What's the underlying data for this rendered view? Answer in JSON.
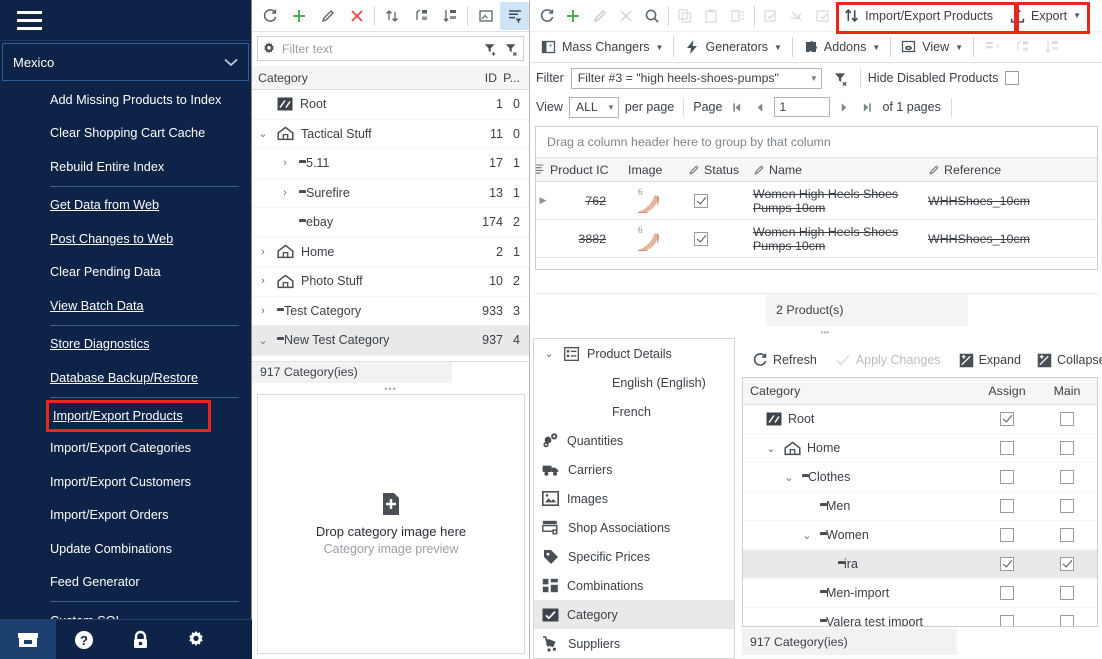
{
  "sidebar": {
    "store_selector": {
      "value": "Mexico",
      "chevron_icon": "chevron-down-icon"
    },
    "menu_groups": [
      {
        "items": [
          {
            "label": "Add Missing Products to Index",
            "mnemonic": ""
          },
          {
            "label": "Clear Shopping Cart Cache",
            "mnemonic": ""
          },
          {
            "label": "Rebuild Entire Index",
            "mnemonic": ""
          }
        ]
      },
      {
        "items": [
          {
            "label": "Get Data from Web",
            "mnemonic": "G"
          },
          {
            "label": "Post Changes to Web",
            "mnemonic": "P"
          },
          {
            "label": "Clear Pending Data",
            "mnemonic": ""
          },
          {
            "label": "View Batch Data",
            "mnemonic": "V"
          }
        ]
      },
      {
        "items": [
          {
            "label": "Store Diagnostics",
            "mnemonic": "D"
          },
          {
            "label": "Database Backup/Restore",
            "mnemonic": "D"
          }
        ]
      },
      {
        "items": [
          {
            "label": "Import/Export Products",
            "mnemonic": "u",
            "highlighted": true
          },
          {
            "label": "Import/Export Categories",
            "mnemonic": ""
          },
          {
            "label": "Import/Export Customers",
            "mnemonic": ""
          },
          {
            "label": "Import/Export Orders",
            "mnemonic": ""
          },
          {
            "label": "Update Combinations",
            "mnemonic": ""
          },
          {
            "label": "Feed Generator",
            "mnemonic": ""
          }
        ]
      },
      {
        "items": [
          {
            "label": "Custom SQL",
            "mnemonic": "Q"
          }
        ]
      }
    ],
    "bottom_bar": [
      {
        "icon": "archive-box-icon",
        "active": true
      },
      {
        "icon": "help-question-icon",
        "active": false
      },
      {
        "icon": "lock-icon",
        "active": false
      },
      {
        "icon": "gear-icon",
        "active": false
      }
    ]
  },
  "category_panel": {
    "toolbar": [
      {
        "icon": "refresh-icon"
      },
      {
        "icon": "add-plus-icon"
      },
      {
        "icon": "edit-pencil-icon"
      },
      {
        "icon": "delete-x-icon"
      },
      {
        "icon": "move-updown-icon"
      },
      {
        "icon": "move-up-level-icon"
      },
      {
        "icon": "sort-descending-icon"
      },
      {
        "icon": "image-toggle-icon"
      },
      {
        "icon": "filter-rows-icon",
        "selected": true
      }
    ],
    "filter_text": {
      "icon": "gear-icon",
      "placeholder": "Filter text",
      "add_filter_icon": "filter-add-icon",
      "clear_filter_icon": "filter-clear-icon"
    },
    "columns": [
      "Category",
      "ID",
      "P..."
    ],
    "rows": [
      {
        "label": "Root",
        "id": "1",
        "p": "0",
        "indent": 0,
        "expander": "",
        "icon": "root-icon",
        "selected": false
      },
      {
        "label": "Tactical Stuff",
        "id": "11",
        "p": "0",
        "indent": 0,
        "expander": "v",
        "icon": "home-icon",
        "selected": false
      },
      {
        "label": "5.11",
        "id": "17",
        "p": "1",
        "indent": 1,
        "expander": ">",
        "icon": "folder-icon",
        "selected": false
      },
      {
        "label": "Surefire",
        "id": "13",
        "p": "1",
        "indent": 1,
        "expander": ">",
        "icon": "folder-icon",
        "selected": false
      },
      {
        "label": "ebay",
        "id": "174",
        "p": "2",
        "indent": 1,
        "expander": "",
        "icon": "folder-icon",
        "selected": false
      },
      {
        "label": "Home",
        "id": "2",
        "p": "1",
        "indent": 0,
        "expander": ">",
        "icon": "home-icon",
        "selected": false
      },
      {
        "label": "Photo Stuff",
        "id": "10",
        "p": "2",
        "indent": 0,
        "expander": ">",
        "icon": "home-icon",
        "selected": false
      },
      {
        "label": "Test Category",
        "id": "933",
        "p": "3",
        "indent": 0,
        "expander": ">",
        "icon": "folder-icon",
        "selected": false
      },
      {
        "label": "New Test Category",
        "id": "937",
        "p": "4",
        "indent": 0,
        "expander": "v",
        "icon": "folder-icon",
        "selected": true
      }
    ],
    "status": "917 Category(ies)",
    "drop_zone": {
      "icon": "add-file-icon",
      "title": "Drop category image here",
      "subtitle": "Category image preview"
    }
  },
  "product_panel": {
    "toolbar_icons": [
      {
        "icon": "refresh-icon",
        "enabled": true
      },
      {
        "icon": "add-plus-icon",
        "enabled": true
      },
      {
        "icon": "edit-pencil-icon",
        "enabled": false
      },
      {
        "icon": "delete-x-icon",
        "enabled": false
      },
      {
        "icon": "search-icon",
        "enabled": true
      },
      {
        "icon": "copy-icon",
        "enabled": false
      },
      {
        "icon": "paste-icon",
        "enabled": false
      },
      {
        "icon": "duplicate-icon",
        "enabled": false
      },
      {
        "icon": "check-all-icon",
        "enabled": false
      },
      {
        "icon": "uncheck-icon",
        "enabled": false
      },
      {
        "icon": "check-selected-icon",
        "enabled": false
      }
    ],
    "import_export_button": {
      "label": "Import/Export Products",
      "mnemonic": "u",
      "icon": "import-export-icon",
      "highlighted": true
    },
    "export_button": {
      "label": "Export",
      "icon": "export-upload-icon",
      "has_caret": true,
      "highlighted": true
    },
    "menu_bar": [
      {
        "label": "Mass Changers",
        "mnemonic": "M",
        "icon": "mass-changers-icon",
        "caret": true
      },
      {
        "label": "Generators",
        "icon": "lightning-icon",
        "caret": true
      },
      {
        "label": "Addons",
        "icon": "puzzle-icon",
        "caret": true
      },
      {
        "label": "View",
        "icon": "eye-view-icon",
        "caret": true
      }
    ],
    "menu_bar_disabled_icons": [
      "sort-alpha-icon",
      "move-up-level-icon",
      "sort-descending-icon"
    ],
    "filter": {
      "label": "Filter",
      "value": "Filter #3 = \"high heels-shoes-pumps\"",
      "clear_icon": "filter-clear-icon",
      "hide_disabled_label": "Hide Disabled Products",
      "hide_disabled_checked": false
    },
    "paging": {
      "view_label": "View",
      "per_page_value": "ALL",
      "per_page_label": "per page",
      "page_label": "Page",
      "page_value": "1",
      "of_pages": "of 1 pages",
      "first_icon": "first-page-icon",
      "prev_icon": "prev-page-icon",
      "next_icon": "next-page-icon",
      "last_icon": "last-page-icon"
    },
    "group_bar_text": "Drag a column header here to group by that column",
    "grid_columns": [
      {
        "label": "Product IC",
        "editable": false
      },
      {
        "label": "Image",
        "editable": false
      },
      {
        "label": "Status",
        "editable": true
      },
      {
        "label": "Name",
        "editable": true
      },
      {
        "label": "Reference",
        "editable": true
      }
    ],
    "grid_rows": [
      {
        "product_id": "762",
        "status_checked": true,
        "name": "Women High Heels Shoes Pumps 10cm",
        "reference": "WHHShoes_10cm",
        "image_icon": "high-heel-shoe-thumbnail",
        "strikethrough": true
      },
      {
        "product_id": "3882",
        "status_checked": true,
        "name": "Women High Heels Shoes Pumps 10cm",
        "reference": "WHHShoes_10cm",
        "image_icon": "high-heel-shoe-thumbnail",
        "strikethrough": true
      }
    ],
    "grid_status": "2 Product(s)"
  },
  "product_details": {
    "header": {
      "label": "Product Details",
      "icon": "details-list-icon",
      "expander": "v"
    },
    "items": [
      {
        "label": "English (English)",
        "icon": "",
        "language": true,
        "selected": false
      },
      {
        "label": "French",
        "icon": "",
        "language": true,
        "selected": false
      },
      {
        "label": "Quantities",
        "icon": "quantities-icon",
        "selected": false
      },
      {
        "label": "Carriers",
        "icon": "truck-carrier-icon",
        "selected": false
      },
      {
        "label": "Images",
        "icon": "image-icon",
        "selected": false
      },
      {
        "label": "Shop Associations",
        "icon": "shop-associations-icon",
        "selected": false
      },
      {
        "label": "Specific Prices",
        "icon": "price-tag-icon",
        "selected": false
      },
      {
        "label": "Combinations",
        "icon": "combinations-icon",
        "selected": false
      },
      {
        "label": "Category",
        "icon": "category-check-icon",
        "selected": true
      },
      {
        "label": "Suppliers",
        "icon": "supplier-cart-icon",
        "selected": false
      }
    ]
  },
  "category_assign_panel": {
    "toolbar": [
      {
        "label": "Refresh",
        "icon": "refresh-icon",
        "enabled": true
      },
      {
        "label": "Apply Changes",
        "icon": "check-apply-icon",
        "enabled": false
      },
      {
        "label": "Expand",
        "icon": "expand-icon",
        "enabled": true
      },
      {
        "label": "Collapse",
        "icon": "collapse-icon",
        "enabled": true
      }
    ],
    "columns": [
      "Category",
      "Assign",
      "Main"
    ],
    "rows": [
      {
        "label": "Root",
        "indent": 0,
        "expander": "",
        "icon": "root-icon",
        "assign": true,
        "main": false,
        "selected": false
      },
      {
        "label": "Home",
        "indent": 1,
        "expander": "v",
        "icon": "home-icon",
        "assign": false,
        "main": false,
        "selected": false
      },
      {
        "label": "Clothes",
        "indent": 2,
        "expander": "v",
        "icon": "folder-icon",
        "assign": false,
        "main": false,
        "selected": false
      },
      {
        "label": "Men",
        "indent": 3,
        "expander": "",
        "icon": "folder-icon",
        "assign": false,
        "main": false,
        "selected": false
      },
      {
        "label": "Women",
        "indent": 3,
        "expander": "v",
        "icon": "folder-icon",
        "assign": false,
        "main": false,
        "selected": false
      },
      {
        "label": "ira",
        "indent": 4,
        "expander": "",
        "icon": "folder-icon",
        "assign": true,
        "main": true,
        "selected": true
      },
      {
        "label": "Men-import",
        "indent": 3,
        "expander": "",
        "icon": "folder-icon",
        "assign": false,
        "main": false,
        "selected": false
      },
      {
        "label": "Valera test import",
        "indent": 3,
        "expander": "",
        "icon": "folder-icon",
        "assign": false,
        "main": false,
        "selected": false
      }
    ],
    "status": "917 Category(ies)"
  },
  "colors": {
    "sidebar_bg": "#0d2448",
    "highlight_red": "#e8271a",
    "accent_green": "#4caf50",
    "accent_red": "#e04a3f",
    "selected_blue": "#cfe4f7",
    "text": "#3b4148"
  }
}
